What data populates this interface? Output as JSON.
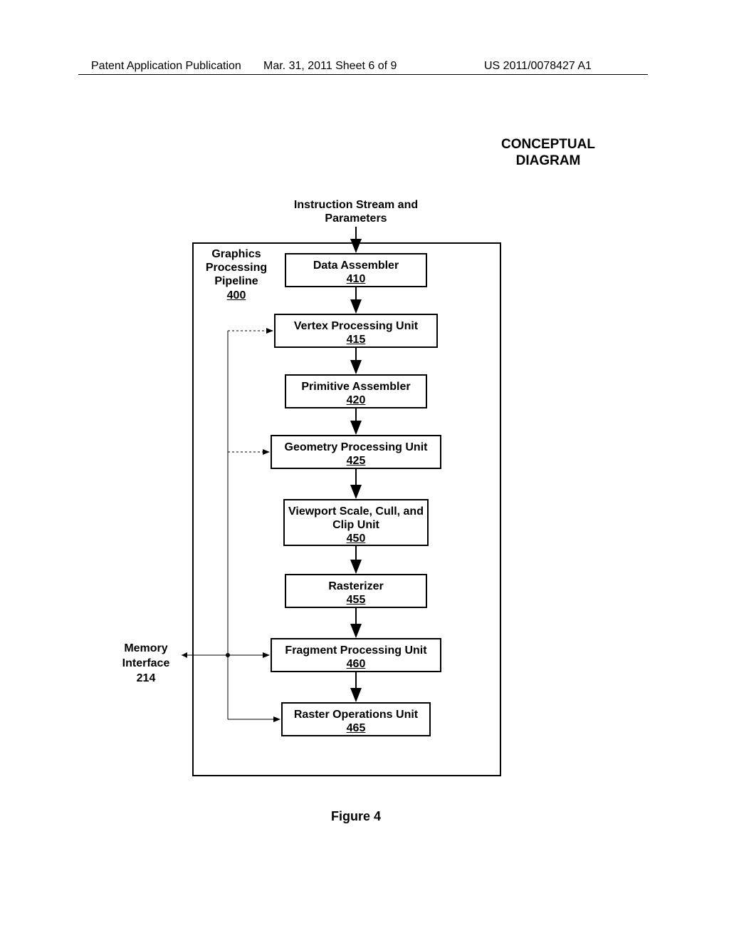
{
  "header": {
    "left": "Patent Application Publication",
    "mid": "Mar. 31, 2011  Sheet 6 of 9",
    "right": "US 2011/0078427 A1"
  },
  "conceptual": "CONCEPTUAL DIAGRAM",
  "input_label": "Instruction Stream and Parameters",
  "pipeline": {
    "title": "Graphics Processing Pipeline",
    "num": "400"
  },
  "blocks": {
    "b410": {
      "title": "Data Assembler",
      "num": "410"
    },
    "b415": {
      "title": "Vertex Processing Unit",
      "num": "415"
    },
    "b420": {
      "title": "Primitive Assembler",
      "num": "420"
    },
    "b425": {
      "title": "Geometry Processing Unit",
      "num": "425"
    },
    "b450": {
      "title": "Viewport Scale, Cull, and Clip Unit",
      "num": "450"
    },
    "b455": {
      "title": "Rasterizer",
      "num": "455"
    },
    "b460": {
      "title": "Fragment Processing Unit",
      "num": "460"
    },
    "b465": {
      "title": "Raster Operations Unit",
      "num": "465"
    }
  },
  "memory": {
    "title": "Memory Interface",
    "num": "214"
  },
  "figure": "Figure 4"
}
